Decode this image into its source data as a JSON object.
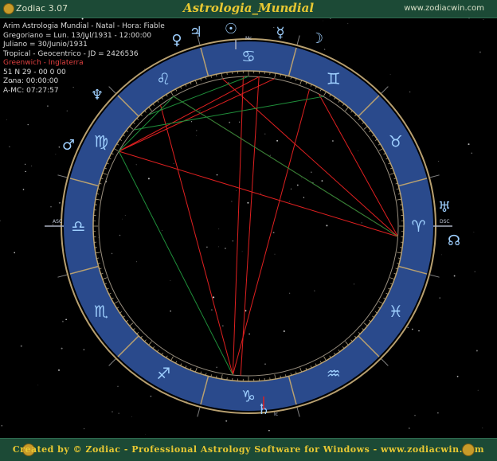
{
  "window": {
    "app_title": "Zodiac 3.07",
    "chart_title": "Astrologia_Mundial",
    "website": "www.zodiacwin.com"
  },
  "chart_info": {
    "lines": [
      "Arim Astrologia Mundial - Natal - Hora: Fiable",
      "Gregoriano = Lun. 13/Jul/1931 - 12:00:00",
      "Juliano = 30/Junio/1931",
      "Tropical - Geocentrico - JD = 2426536",
      "Greenwich - Inglaterra",
      "51 N 29 - 00 0 00",
      "Zona: 00:00:00",
      "A-MC: 07:27:57"
    ]
  },
  "zodiac_signs": [
    "aries-icon",
    "taurus-icon",
    "gemini-icon",
    "cancer-icon",
    "leo-icon",
    "virgo-icon",
    "libra-icon",
    "scorpio-icon",
    "sagittarius-icon",
    "capricorn-icon",
    "aquarius-icon",
    "pisces-icon"
  ],
  "sign_glyphs": [
    "♈",
    "♉",
    "♊",
    "♋",
    "♌",
    "♍",
    "♎",
    "♏",
    "♐",
    "♑",
    "♒",
    "♓"
  ],
  "planets": {
    "jupiter": "♃",
    "venus": "♀",
    "sun": "☉",
    "mercury": "☿",
    "moon": "☽",
    "neptune": "♆",
    "mars": "♂",
    "uranus": "♅",
    "node": "☊",
    "saturn": "♄"
  },
  "axis_labels": {
    "asc": "ASC",
    "desc": "DSC",
    "mc": "Mc",
    "ic": "Ic"
  },
  "colors": {
    "wheel_band": "#2a4a8c",
    "wheel_border": "#b8a070",
    "glyph": "#9fd0ff",
    "aspect_red": "#e02020",
    "aspect_green": "#1f8f3a",
    "title_gold": "#e8c832",
    "chrome": "#1c4a36"
  },
  "footer": {
    "text": "Created by © Zodiac - Professional Astrology Software for Windows - www.zodiacwin.com"
  }
}
